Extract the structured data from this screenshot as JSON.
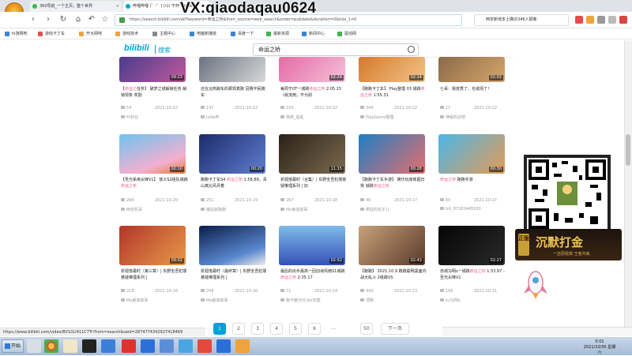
{
  "browser": {
    "tabs": [
      {
        "label": "360导航_一个主页，整个世界",
        "active": false
      },
      {
        "label": "哔哩哔哩 (゜-゜)つロ 干杯~-bilibili",
        "active": true
      }
    ],
    "url": "https://search.bilibili.com/all?keyword=命运之桥&from_source=web_search&order=pubdate&duration=0&tids_1=0",
    "search_value": "西安新增本土确诊346人隔离",
    "bookmarks": [
      "hi游网吧",
      "游戏卡丁车",
      "开大网吧",
      "游戏技术",
      "主题中心",
      "电脑新播放",
      "百度一下",
      "最新资源",
      "新闻中心",
      "驱动网"
    ]
  },
  "watermark": "VX:qiaodaqau0624",
  "site": {
    "logo": "bilibili",
    "section": "搜索",
    "query": "命运之桥"
  },
  "rows": [
    [
      {
        "duration": "09:23",
        "title_pre": "【",
        "hl": "命运之",
        "title_post": "任务】 破梦之城解锁任务 解锁现象 奖励",
        "views": "54",
        "date": "2021-10-22",
        "author": "叶秋钰"
      },
      {
        "duration": "",
        "title_pre": "还在淡热跑车的那现真跑 冠赛平民跑车",
        "hl": "",
        "title_post": "",
        "views": "147",
        "date": "2021-10-22",
        "author": "Jutie冉"
      },
      {
        "duration": "02:24",
        "title_pre": "每周于0T一城跳",
        "hl": "命运之桥",
        "title_post": " 2:05.15（就流用，不为别",
        "views": "155",
        "date": "2021-10-22",
        "author": "我想_是乱"
      },
      {
        "duration": "02:14",
        "title_pre": "【跑跑卡丁车】 Play整理 03 城跳",
        "hl": "命运之桥",
        "title_post": " 1:55.31",
        "views": "349",
        "date": "2021-10-22",
        "author": "PlayGame整理"
      },
      {
        "duration": "02:02",
        "title_pre": "七哥：我变秀了，也说情了！",
        "hl": "",
        "title_post": "",
        "views": "11",
        "date": "2021-10-22",
        "author": "神秘的店吧"
      }
    ],
    [
      {
        "duration": "02:10",
        "title_pre": "【圣光系疾尖锋V1】 放义S2组队城跳",
        "hl": "命运之桥",
        "title_post": "",
        "views": "284",
        "date": "2021-10-20",
        "author": "西安机哥"
      },
      {
        "duration": "00:20",
        "title_pre": "跑跑卡丁车S4 ",
        "hl": "命运之桥",
        "title_post": " 1:58.89。青山真比风月着",
        "views": "251",
        "date": "2021-10-19",
        "author": "猪站就跑跑"
      },
      {
        "duration": "11:15",
        "title_pre": "折翅落幕时（合集）| 东野圭吾犯罪悬疑推理系列 | 扣",
        "hl": "",
        "title_post": "",
        "views": "267",
        "date": "2021-10-18",
        "author": "Mo番诶故事"
      },
      {
        "duration": "00:28",
        "title_pre": "【跑跑卡丁车手游】 娱乐玩家练图日常 城跳",
        "hl": "命运之桥",
        "title_post": "",
        "views": "46",
        "date": "2021-10-17",
        "author": "疯狂的饺子儿"
      },
      {
        "duration": "00:30",
        "title_pre": "",
        "hl": "命运之桥",
        "title_post": " 跑跑手游",
        "views": "60",
        "date": "2021-10-17",
        "author": "bili_87281445930"
      }
    ],
    [
      {
        "duration": "09:02",
        "title_pre": "折翅落幕时（第三章）| 东野圭吾犯罪悬疑推理系列 |",
        "hl": "",
        "title_post": "",
        "views": "218",
        "date": "2021-10-16",
        "author": "Mo番诶故事"
      },
      {
        "duration": "",
        "title_pre": "折翅落幕时（最终章）| 东野圭吾犯罪悬疑推理系列 |",
        "hl": "",
        "title_post": "",
        "views": "208",
        "date": "2021-10-16",
        "author": "Mo番诶故事"
      },
      {
        "duration": "02:52",
        "title_pre": "最后的出手最高一回创诗风雨S1城跳",
        "hl": "命运之桥",
        "title_post": " 2:35.17",
        "views": "71",
        "date": "2021-10-14",
        "author": "跑卡聚光灯/ski定案"
      },
      {
        "duration": "02:43",
        "title_pre": "【跑跑】 2021.10.9 跑跑聪明黑面内战大乱斗 2组跳VS",
        "hl": "",
        "title_post": "",
        "views": "443",
        "date": "2021-10-13",
        "author": "顶跑"
      },
      {
        "duration": "02:27",
        "title_pre": "赤城马明s一城跳",
        "hl": "命运之桥",
        "title_post": " 1.53.97 -圣光尖锋V1",
        "views": "195",
        "date": "2021-10-11",
        "author": "tcl马明s"
      }
    ]
  ],
  "ad": {
    "title": "沉默打金",
    "sub": "一还原经典 王者归来",
    "tag": "正版"
  },
  "pager": [
    "1",
    "2",
    "3",
    "4",
    "5",
    "6",
    "...",
    "50",
    "下一页"
  ],
  "status_url": "https://www.bilibili.com/video/BV1GU411C7Tr?from=search&seid=2874774342927418469",
  "taskbar": {
    "start": "开始",
    "clock_time": "0:01",
    "clock_date": "2021/10/30 星期六"
  }
}
